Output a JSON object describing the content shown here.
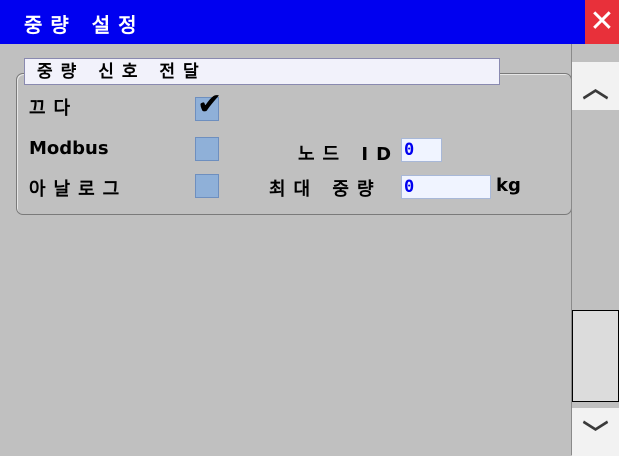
{
  "window": {
    "title": "중량 설정",
    "close_label": "✕"
  },
  "group": {
    "title": "중량 신호 전달"
  },
  "rows": {
    "off": {
      "label": "끄다",
      "checked": true
    },
    "modbus": {
      "label": "Modbus",
      "checked": false,
      "node_label": "노드 ID",
      "node_value": "0"
    },
    "analog": {
      "label": "아날로그",
      "checked": false,
      "max_label": "최대 중량",
      "max_value": "0",
      "unit": "kg"
    }
  },
  "scrollbar": {
    "up_icon": "chevron-up-icon",
    "down_icon": "chevron-down-icon"
  },
  "colors": {
    "titlebar": "#0000f0",
    "close": "#e8303a",
    "value_text": "#0000f0",
    "checkbox": "#8fb0d8"
  }
}
